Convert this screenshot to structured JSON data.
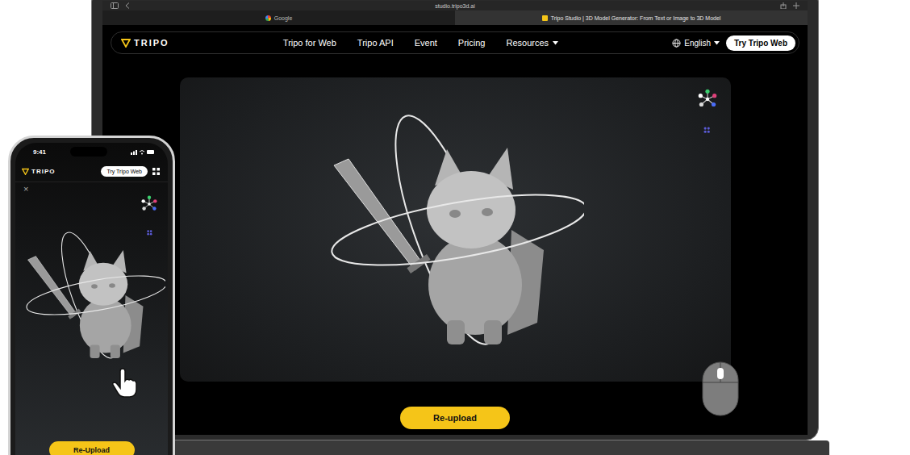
{
  "browser": {
    "address": "studio.tripo3d.ai",
    "tabs": [
      {
        "label": "Google",
        "selected": false
      },
      {
        "label": "Tripo Studio | 3D Model Generator: From Text or Image to 3D Model",
        "selected": true
      }
    ]
  },
  "site": {
    "logo": "TRIPO",
    "nav": [
      {
        "label": "Tripo for Web",
        "dropdown": false
      },
      {
        "label": "Tripo API",
        "dropdown": false
      },
      {
        "label": "Event",
        "dropdown": false
      },
      {
        "label": "Pricing",
        "dropdown": false
      },
      {
        "label": "Resources",
        "dropdown": true
      }
    ],
    "language": "English",
    "cta": "Try Tripo Web",
    "reupload": "Re-upload"
  },
  "phone": {
    "time": "9:41",
    "logo": "TRIPO",
    "cta": "Try Tripo Web",
    "close": "×",
    "reupload": "Re-Upload"
  }
}
